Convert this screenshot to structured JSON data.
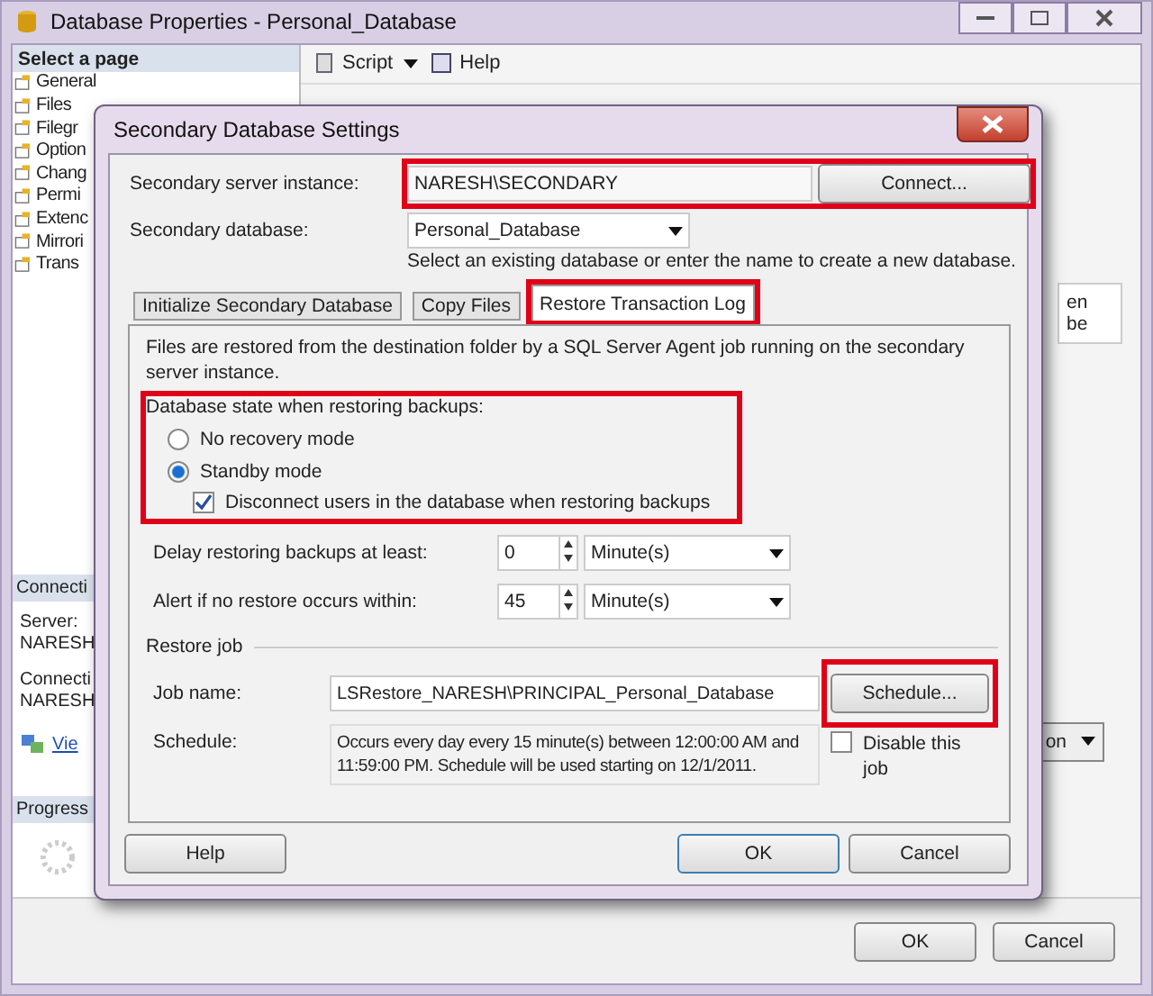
{
  "window": {
    "title": "Database Properties - Personal_Database",
    "sidebar": {
      "heading": "Select a page",
      "items": [
        {
          "label": "General"
        },
        {
          "label": "Files"
        },
        {
          "label": "Filegr"
        },
        {
          "label": "Option"
        },
        {
          "label": "Chang"
        },
        {
          "label": "Permi"
        },
        {
          "label": "Extenc"
        },
        {
          "label": "Mirrori"
        },
        {
          "label": "Trans"
        }
      ]
    },
    "connection": {
      "heading": "Connecti",
      "server_label": "Server:",
      "server": "NARESH",
      "connection_label": "Connecti",
      "connection": "NARESH",
      "link": "Vie"
    },
    "progress": {
      "heading": "Progress"
    },
    "toolbar": {
      "script": "Script",
      "help": "Help"
    },
    "right_fragments": [
      "en",
      "be"
    ],
    "dropdown": "on",
    "buttons": {
      "ok": "OK",
      "cancel": "Cancel"
    }
  },
  "dialog": {
    "title": "Secondary Database Settings",
    "server": {
      "label": "Secondary server instance:",
      "value": "NARESH\\SECONDARY",
      "button": "Connect...",
      "highlighted": true
    },
    "database": {
      "label": "Secondary database:",
      "value": "Personal_Database",
      "hint": "Select an existing database or enter the name to create a new database."
    },
    "tabs": [
      {
        "label": "Initialize Secondary Database",
        "selected": false,
        "highlighted": false
      },
      {
        "label": "Copy Files",
        "selected": false,
        "highlighted": false
      },
      {
        "label": "Restore Transaction Log",
        "selected": true,
        "highlighted": true
      }
    ],
    "description": "Files are restored from the destination folder by a SQL Server Agent job running on the secondary server instance.",
    "state_group": {
      "label": "Database state when restoring backups:",
      "highlighted": true,
      "options": [
        {
          "label": "No recovery mode",
          "selected": false
        },
        {
          "label": "Standby mode",
          "selected": true
        }
      ],
      "disconnect": {
        "label": "Disconnect users in the database when restoring backups",
        "checked": true
      }
    },
    "delay": {
      "label": "Delay restoring backups at least:",
      "value": "0",
      "unit": "Minute(s)"
    },
    "alert": {
      "label": "Alert if no restore occurs within:",
      "value": "45",
      "unit": "Minute(s)"
    },
    "restore_job": {
      "legend": "Restore job",
      "job_label": "Job name:",
      "job_name": "LSRestore_NARESH\\PRINCIPAL_Personal_Database",
      "schedule_button": {
        "label": "Schedule...",
        "highlighted": true
      },
      "schedule_label": "Schedule:",
      "schedule": "Occurs every day every 15 minute(s) between 12:00:00 AM and 11:59:00 PM. Schedule will be used starting on 12/1/2011.",
      "disable": {
        "label": "Disable this job",
        "checked": false
      }
    },
    "buttons": {
      "help": "Help",
      "ok": "OK",
      "cancel": "Cancel"
    }
  }
}
